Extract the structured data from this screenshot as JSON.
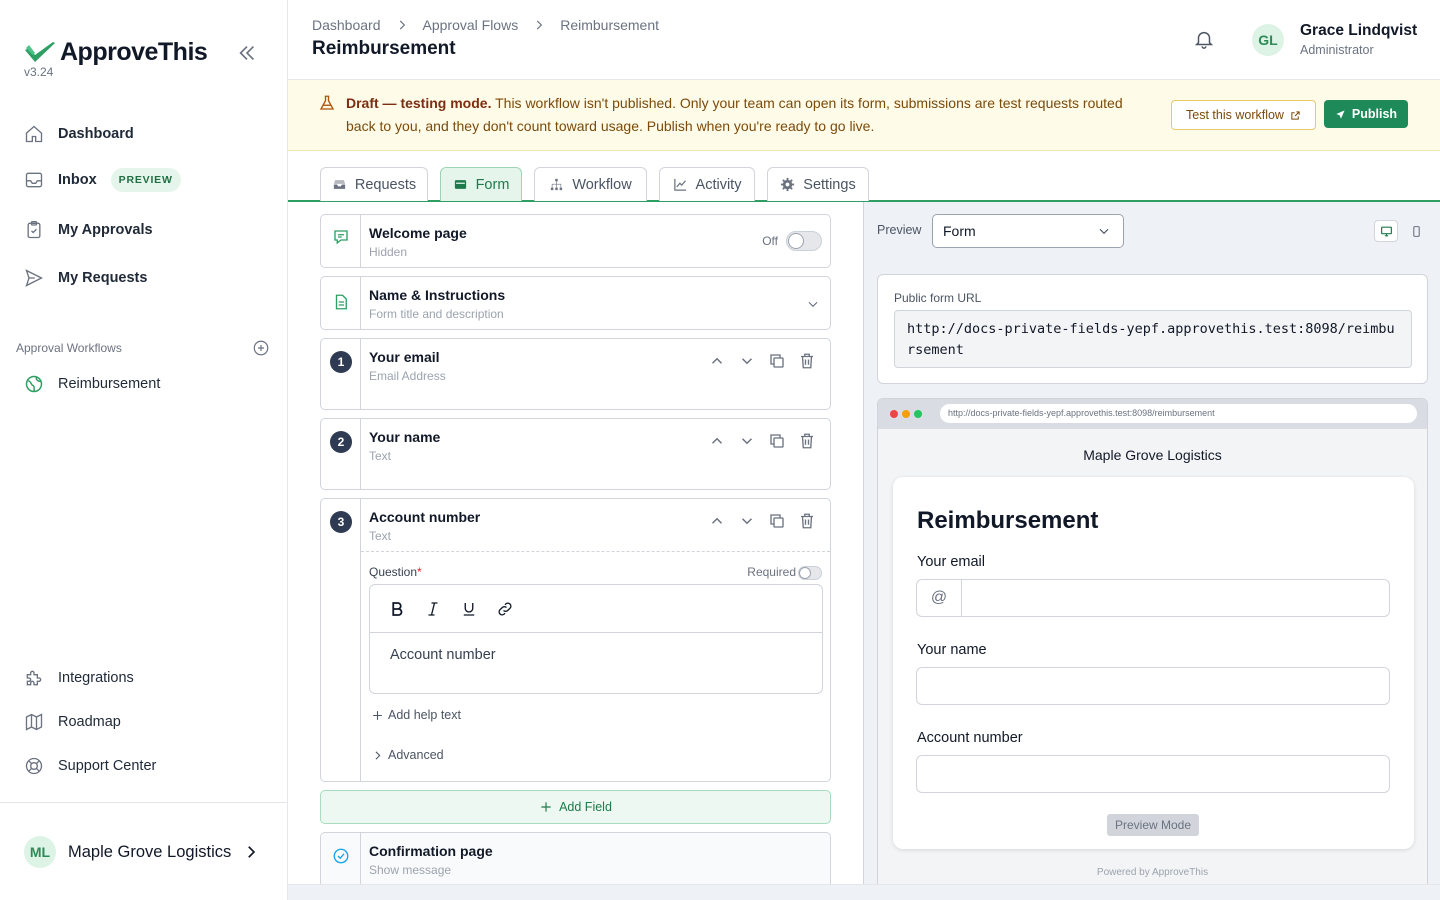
{
  "app": {
    "name": "ApproveThis",
    "version": "v3.24",
    "brand_color": "#2e9e63"
  },
  "sidebar": {
    "items": [
      {
        "label": "Dashboard",
        "icon": "home-icon"
      },
      {
        "label": "Inbox",
        "icon": "inbox-icon",
        "badge": "PREVIEW"
      },
      {
        "label": "My Approvals",
        "icon": "clipboard-check-icon"
      },
      {
        "label": "My Requests",
        "icon": "send-icon"
      }
    ],
    "section_label": "Approval Workflows",
    "workflows": [
      {
        "label": "Reimbursement",
        "icon": "globe-icon"
      }
    ],
    "footer_items": [
      {
        "label": "Integrations",
        "icon": "puzzle-icon"
      },
      {
        "label": "Roadmap",
        "icon": "map-icon"
      },
      {
        "label": "Support Center",
        "icon": "lifebuoy-icon"
      }
    ],
    "org": {
      "initials": "ML",
      "name": "Maple Grove Logistics"
    }
  },
  "header": {
    "breadcrumb": [
      "Dashboard",
      "Approval Flows",
      "Reimbursement"
    ],
    "title": "Reimbursement",
    "user": {
      "initials": "GL",
      "name": "Grace Lindqvist",
      "role": "Administrator"
    }
  },
  "banner": {
    "strong": "Draft — testing mode.",
    "text": " This workflow isn't published. Only your team can open its form, submissions are test requests routed back to you, and they don't count toward usage. Publish when you're ready to go live.",
    "test_label": "Test this workflow",
    "publish_label": "Publish"
  },
  "tabs": [
    {
      "label": "Requests",
      "icon": "inbox-tray-icon"
    },
    {
      "label": "Form",
      "icon": "form-icon",
      "active": true
    },
    {
      "label": "Workflow",
      "icon": "sitemap-icon"
    },
    {
      "label": "Activity",
      "icon": "chart-line-icon"
    },
    {
      "label": "Settings",
      "icon": "gear-icon"
    }
  ],
  "builder": {
    "welcome": {
      "title": "Welcome page",
      "subtitle": "Hidden",
      "toggle_label": "Off"
    },
    "name_instructions": {
      "title": "Name & Instructions",
      "subtitle": "Form title and description"
    },
    "fields": [
      {
        "number": "1",
        "title": "Your email",
        "type": "Email Address"
      },
      {
        "number": "2",
        "title": "Your name",
        "type": "Text"
      },
      {
        "number": "3",
        "title": "Account number",
        "type": "Text"
      }
    ],
    "expanded": {
      "question_label": "Question",
      "required_mark": "*",
      "required_label": "Required",
      "question_text": "Account number",
      "add_help": "Add help text",
      "advanced": "Advanced"
    },
    "add_field": "Add Field",
    "confirmation": {
      "title": "Confirmation page",
      "subtitle": "Show message"
    }
  },
  "preview": {
    "label": "Preview",
    "mode": "Form",
    "url_label": "Public form URL",
    "url": "http://docs-private-fields-yepf.approvethis.test:8098/reimbursement",
    "browser_url": "http://docs-private-fields-yepf.approvethis.test:8098/reimbursement",
    "org_name": "Maple Grove Logistics",
    "form_title": "Reimbursement",
    "fields": [
      "Your email",
      "Your name",
      "Account number"
    ],
    "email_addon": "@",
    "preview_mode": "Preview Mode",
    "powered_by": "Powered by ApproveThis"
  }
}
